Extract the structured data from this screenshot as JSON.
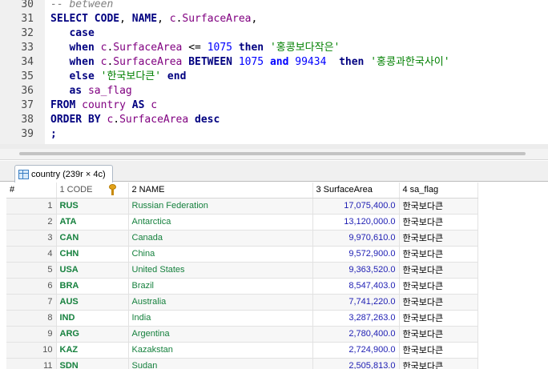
{
  "editor": {
    "lines": [
      {
        "no": "30",
        "tokens": [
          {
            "c": "cm",
            "t": "-- between"
          }
        ]
      },
      {
        "no": "31",
        "tokens": [
          {
            "c": "kw",
            "t": "SELECT"
          },
          {
            "c": "id",
            "t": " "
          },
          {
            "c": "kw",
            "t": "CODE"
          },
          {
            "c": "id",
            "t": ", "
          },
          {
            "c": "kw",
            "t": "NAME"
          },
          {
            "c": "id",
            "t": ", "
          },
          {
            "c": "al",
            "t": "c"
          },
          {
            "c": "id",
            "t": "."
          },
          {
            "c": "al",
            "t": "SurfaceArea"
          },
          {
            "c": "id",
            "t": ","
          }
        ]
      },
      {
        "no": "32",
        "tokens": [
          {
            "c": "id",
            "t": "   "
          },
          {
            "c": "kw",
            "t": "case"
          }
        ]
      },
      {
        "no": "33",
        "tokens": [
          {
            "c": "id",
            "t": "   "
          },
          {
            "c": "kw",
            "t": "when"
          },
          {
            "c": "id",
            "t": " "
          },
          {
            "c": "al",
            "t": "c"
          },
          {
            "c": "id",
            "t": "."
          },
          {
            "c": "al",
            "t": "SurfaceArea"
          },
          {
            "c": "op",
            "t": " <= "
          },
          {
            "c": "num",
            "t": "1075"
          },
          {
            "c": "id",
            "t": " "
          },
          {
            "c": "kw",
            "t": "then"
          },
          {
            "c": "id",
            "t": " "
          },
          {
            "c": "str",
            "t": "'홍콩보다작은'"
          }
        ]
      },
      {
        "no": "34",
        "tokens": [
          {
            "c": "id",
            "t": "   "
          },
          {
            "c": "kw",
            "t": "when"
          },
          {
            "c": "id",
            "t": " "
          },
          {
            "c": "al",
            "t": "c"
          },
          {
            "c": "id",
            "t": "."
          },
          {
            "c": "al",
            "t": "SurfaceArea"
          },
          {
            "c": "id",
            "t": " "
          },
          {
            "c": "kw",
            "t": "BETWEEN"
          },
          {
            "c": "id",
            "t": " "
          },
          {
            "c": "num",
            "t": "1075"
          },
          {
            "c": "id",
            "t": " "
          },
          {
            "c": "kw-blue",
            "t": "and"
          },
          {
            "c": "id",
            "t": " "
          },
          {
            "c": "num",
            "t": "99434"
          },
          {
            "c": "id",
            "t": "  "
          },
          {
            "c": "kw",
            "t": "then"
          },
          {
            "c": "id",
            "t": " "
          },
          {
            "c": "str",
            "t": "'홍콩과한국사이'"
          }
        ]
      },
      {
        "no": "35",
        "tokens": [
          {
            "c": "id",
            "t": "   "
          },
          {
            "c": "kw",
            "t": "else"
          },
          {
            "c": "id",
            "t": " "
          },
          {
            "c": "str",
            "t": "'한국보다큰'"
          },
          {
            "c": "id",
            "t": " "
          },
          {
            "c": "kw",
            "t": "end"
          }
        ]
      },
      {
        "no": "36",
        "tokens": [
          {
            "c": "id",
            "t": "   "
          },
          {
            "c": "kw",
            "t": "as"
          },
          {
            "c": "id",
            "t": " "
          },
          {
            "c": "al",
            "t": "sa_flag"
          }
        ]
      },
      {
        "no": "37",
        "tokens": [
          {
            "c": "kw",
            "t": "FROM"
          },
          {
            "c": "id",
            "t": " "
          },
          {
            "c": "al",
            "t": "country"
          },
          {
            "c": "id",
            "t": " "
          },
          {
            "c": "kw",
            "t": "AS"
          },
          {
            "c": "id",
            "t": " "
          },
          {
            "c": "al",
            "t": "c"
          }
        ]
      },
      {
        "no": "38",
        "tokens": [
          {
            "c": "kw",
            "t": "ORDER"
          },
          {
            "c": "id",
            "t": " "
          },
          {
            "c": "kw",
            "t": "BY"
          },
          {
            "c": "id",
            "t": " "
          },
          {
            "c": "al",
            "t": "c"
          },
          {
            "c": "id",
            "t": "."
          },
          {
            "c": "al",
            "t": "SurfaceArea"
          },
          {
            "c": "id",
            "t": " "
          },
          {
            "c": "kw",
            "t": "desc"
          }
        ]
      },
      {
        "no": "39",
        "tokens": [
          {
            "c": "kw",
            "t": ";"
          }
        ]
      }
    ]
  },
  "result_tab": {
    "label": "country (239r × 4c)",
    "icon": "table-icon"
  },
  "grid": {
    "row_num_header": "#",
    "columns": [
      "1 CODE",
      "2 NAME",
      "3 SurfaceArea",
      "4 sa_flag"
    ],
    "rows": [
      [
        "1",
        "RUS",
        "Russian Federation",
        "17,075,400.0",
        "한국보다큰"
      ],
      [
        "2",
        "ATA",
        "Antarctica",
        "13,120,000.0",
        "한국보다큰"
      ],
      [
        "3",
        "CAN",
        "Canada",
        "9,970,610.0",
        "한국보다큰"
      ],
      [
        "4",
        "CHN",
        "China",
        "9,572,900.0",
        "한국보다큰"
      ],
      [
        "5",
        "USA",
        "United States",
        "9,363,520.0",
        "한국보다큰"
      ],
      [
        "6",
        "BRA",
        "Brazil",
        "8,547,403.0",
        "한국보다큰"
      ],
      [
        "7",
        "AUS",
        "Australia",
        "7,741,220.0",
        "한국보다큰"
      ],
      [
        "8",
        "IND",
        "India",
        "3,287,263.0",
        "한국보다큰"
      ],
      [
        "9",
        "ARG",
        "Argentina",
        "2,780,400.0",
        "한국보다큰"
      ],
      [
        "10",
        "KAZ",
        "Kazakstan",
        "2,724,900.0",
        "한국보다큰"
      ],
      [
        "11",
        "SDN",
        "Sudan",
        "2,505,813.0",
        "한국보다큰"
      ]
    ]
  }
}
